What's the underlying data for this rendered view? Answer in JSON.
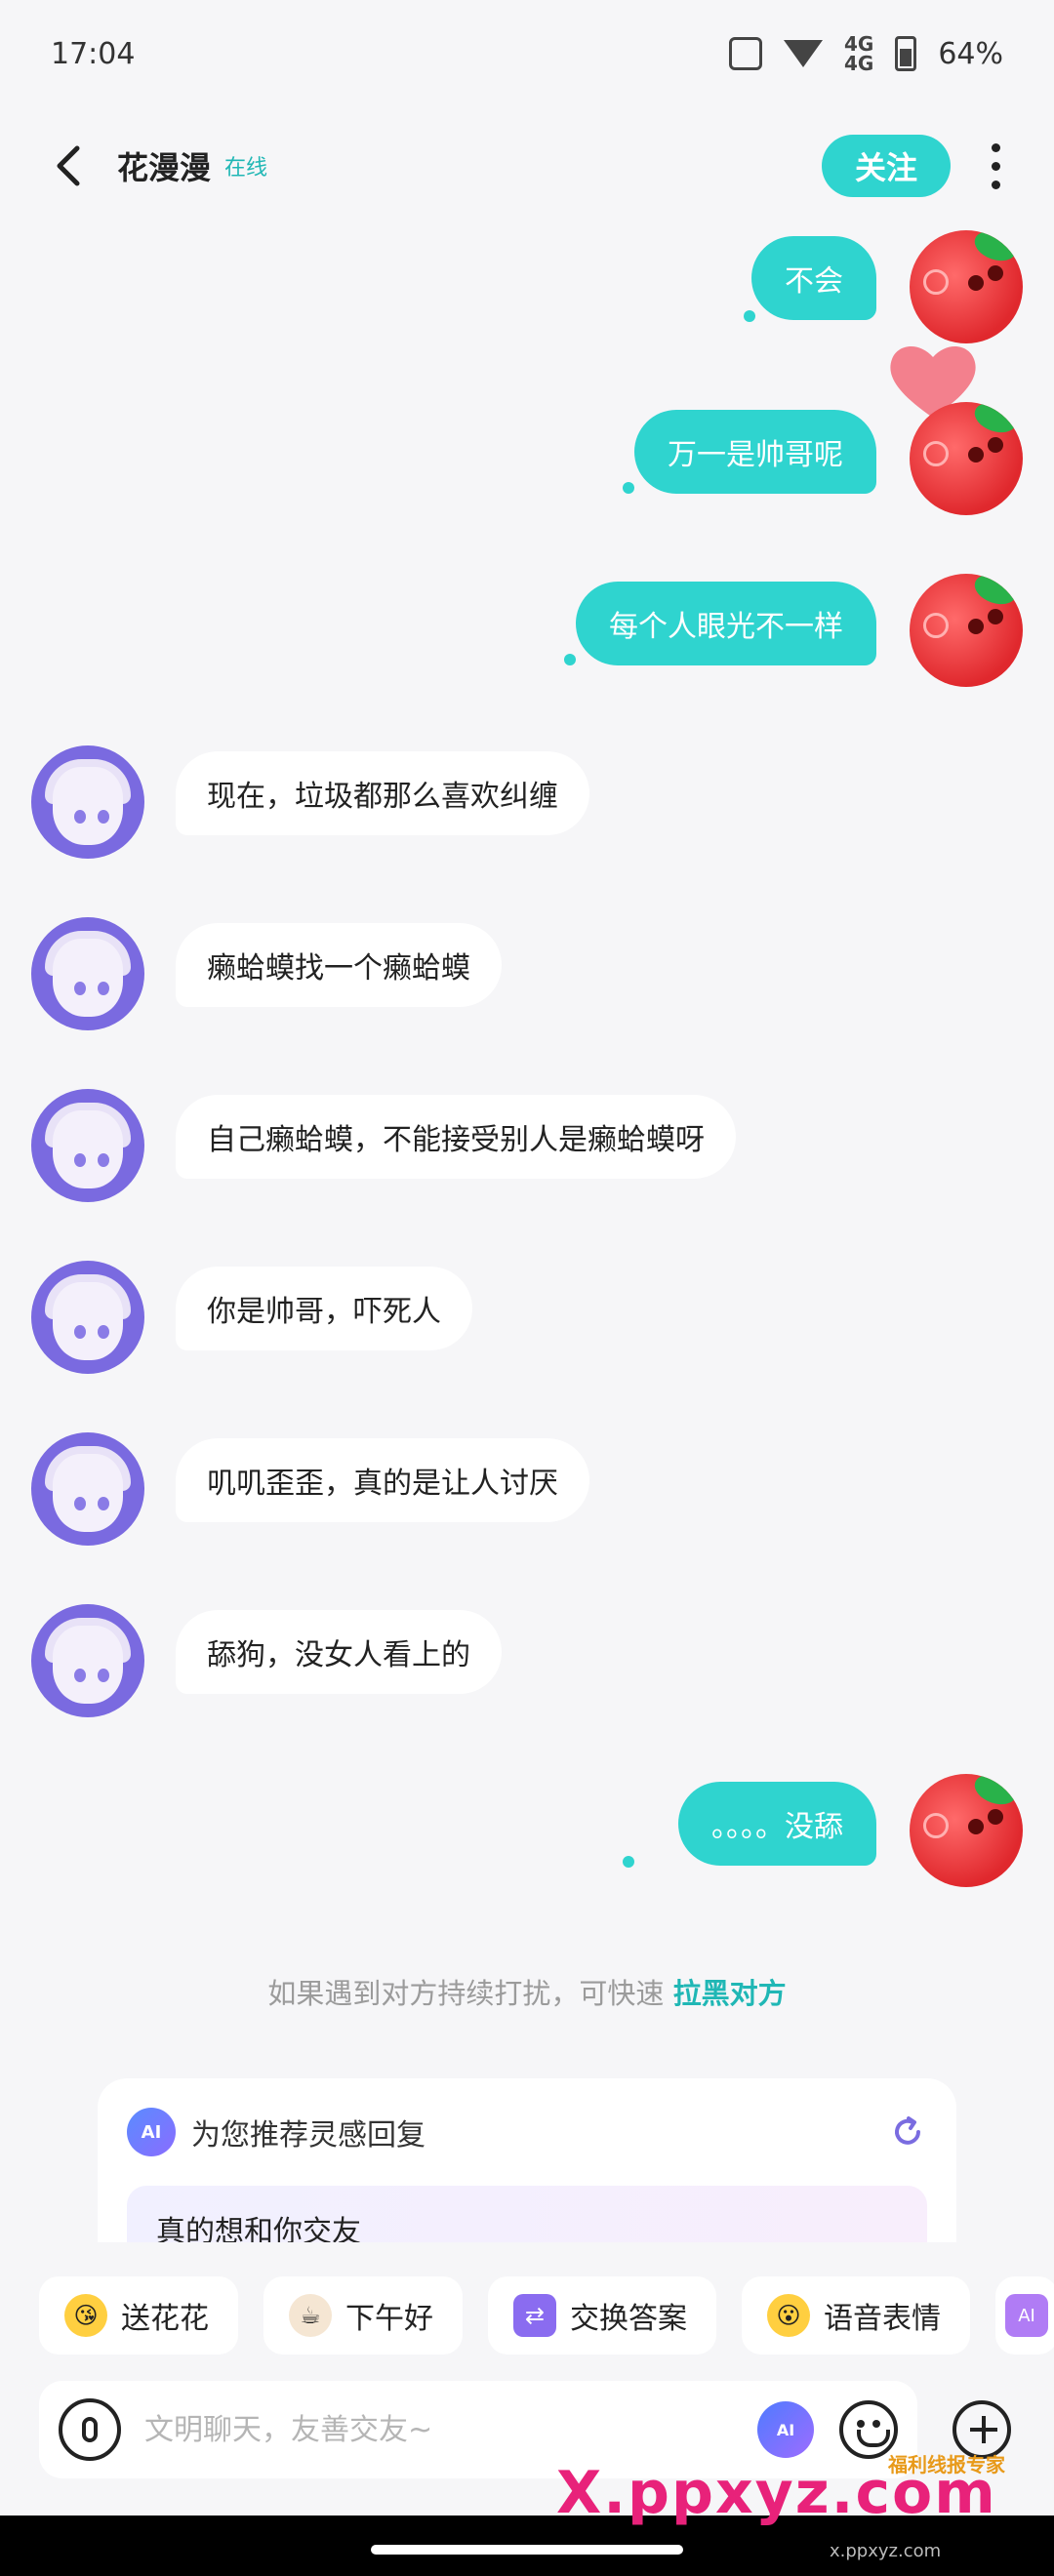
{
  "status_bar": {
    "time": "17:04",
    "battery": "64%"
  },
  "header": {
    "title": "花漫漫",
    "online": "在线",
    "follow": "关注"
  },
  "messages": [
    {
      "side": "out",
      "text": "不会"
    },
    {
      "side": "out",
      "text": "万一是帅哥呢"
    },
    {
      "side": "out",
      "text": "每个人眼光不一样"
    },
    {
      "side": "in",
      "text": "现在，垃圾都那么喜欢纠缠"
    },
    {
      "side": "in",
      "text": "癞蛤蟆找一个癞蛤蟆"
    },
    {
      "side": "in",
      "text": "自己癞蛤蟆，不能接受别人是癞蛤蟆呀"
    },
    {
      "side": "in",
      "text": "你是帅哥，吓死人"
    },
    {
      "side": "in",
      "text": "叽叽歪歪，真的是让人讨厌"
    },
    {
      "side": "in",
      "text": "舔狗，没女人看上的"
    },
    {
      "side": "out",
      "text": "。。。。没舔"
    }
  ],
  "notice": {
    "text": "如果遇到对方持续打扰，可快速 ",
    "link": "拉黑对方"
  },
  "recommend": {
    "title": "为您推荐灵感回复",
    "item": "真的想和你交友",
    "ai_badge": "AI"
  },
  "quick_actions": [
    "送花花",
    "下午好",
    "交换答案",
    "语音表情"
  ],
  "input": {
    "placeholder": "文明聊天，友善交友~"
  },
  "watermark": {
    "main": "X.ppxyz.com",
    "sub": "福利线报专家",
    "url": "x.ppxyz.com"
  }
}
